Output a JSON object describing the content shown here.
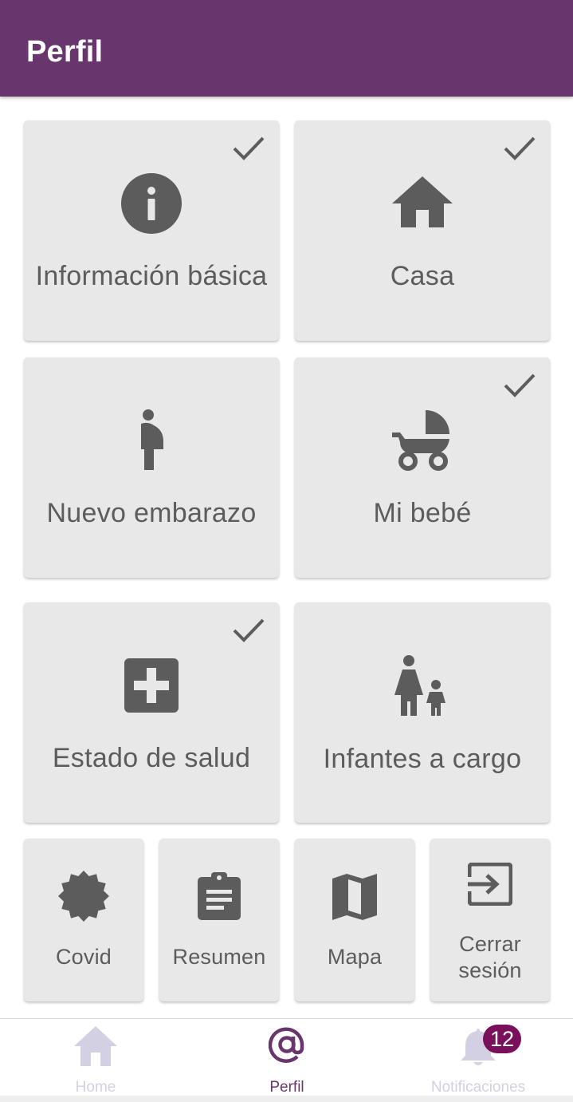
{
  "appbar": {
    "title": "Perfil"
  },
  "cards": {
    "info_basica": {
      "label": "Información básica",
      "completed": true,
      "icon": "info-icon"
    },
    "casa": {
      "label": "Casa",
      "completed": true,
      "icon": "home-icon"
    },
    "nuevo_embarazo": {
      "label": "Nuevo embarazo",
      "completed": false,
      "icon": "pregnant-woman-icon"
    },
    "mi_bebe": {
      "label": "Mi bebé",
      "completed": true,
      "icon": "stroller-icon"
    },
    "estado_salud": {
      "label": "Estado de salud",
      "completed": true,
      "icon": "medical-cross-icon"
    },
    "infantes": {
      "label": "Infantes a cargo",
      "completed": false,
      "icon": "mother-child-icon"
    }
  },
  "small_cards": {
    "covid": {
      "label": "Covid",
      "icon": "virus-badge-icon"
    },
    "resumen": {
      "label": "Resumen",
      "icon": "clipboard-icon"
    },
    "mapa": {
      "label": "Mapa",
      "icon": "map-icon"
    },
    "cerrar_sesion": {
      "label_line1": "Cerrar",
      "label_line2": "sesión",
      "icon": "exit-icon"
    }
  },
  "bottom_nav": {
    "home": {
      "label": "Home",
      "icon": "home-icon",
      "active": false
    },
    "perfil": {
      "label": "Perfil",
      "icon": "at-sign-icon",
      "active": true
    },
    "notificaciones": {
      "label": "Notificaciones",
      "icon": "bell-icon",
      "active": false,
      "badge": "12"
    }
  },
  "colors": {
    "primary": "#68356c",
    "card_bg": "#e8e8e8",
    "icon": "#5c5c5c",
    "inactive_nav": "#d3d0e3",
    "badge": "#7a0f5c"
  }
}
